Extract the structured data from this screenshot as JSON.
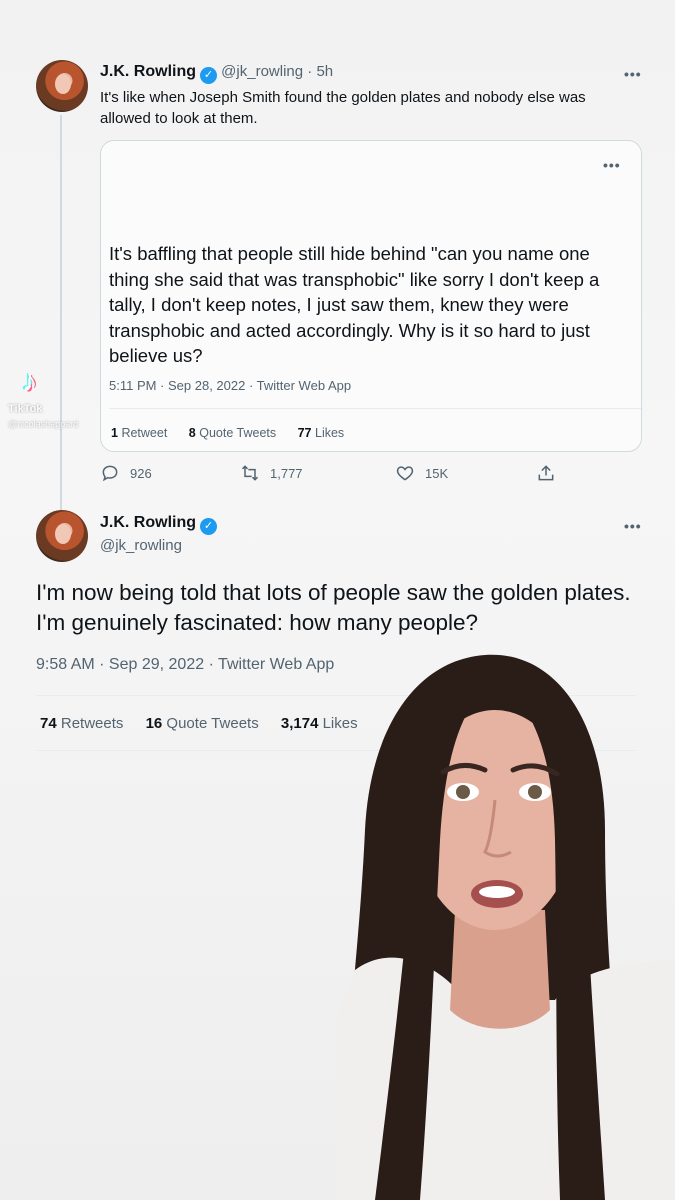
{
  "tweet1": {
    "name": "J.K. Rowling",
    "handle": "@jk_rowling",
    "separator": "·",
    "time_ago": "5h",
    "text": "It's like when Joseph Smith found the golden plates and nobody else was allowed to look at them.",
    "more": "•••"
  },
  "quote": {
    "more": "•••",
    "text": "It's baffling that people still hide behind \"can you name one thing she said that was transphobic\" like sorry I don't keep a tally, I don't keep notes, I just saw them, knew they were transphobic and acted accordingly. Why is it so hard to just believe us?",
    "meta": "5:11 PM · Sep 28, 2022 · Twitter Web App",
    "stats": [
      {
        "count": "1",
        "label": "Retweet"
      },
      {
        "count": "8",
        "label": "Quote Tweets"
      },
      {
        "count": "77",
        "label": "Likes"
      }
    ]
  },
  "actions": {
    "replies": "926",
    "retweets": "1,777",
    "likes": "15K"
  },
  "tweet2": {
    "name": "J.K. Rowling",
    "handle": "@jk_rowling",
    "more": "•••",
    "text": "I'm now being told that lots of people saw the golden plates. I'm genuinely fascinated: how many people?",
    "meta": "9:58 AM · Sep 29, 2022 · Twitter Web App",
    "stats": [
      {
        "count": "74",
        "label": "Retweets"
      },
      {
        "count": "16",
        "label": "Quote Tweets"
      },
      {
        "count": "3,174",
        "label": "Likes"
      }
    ]
  },
  "watermark": {
    "app": "TikTok",
    "user": "@nicolasheppard"
  },
  "colors": {
    "verified": "#1d9bf0",
    "muted": "#536471",
    "text": "#0f1419"
  }
}
